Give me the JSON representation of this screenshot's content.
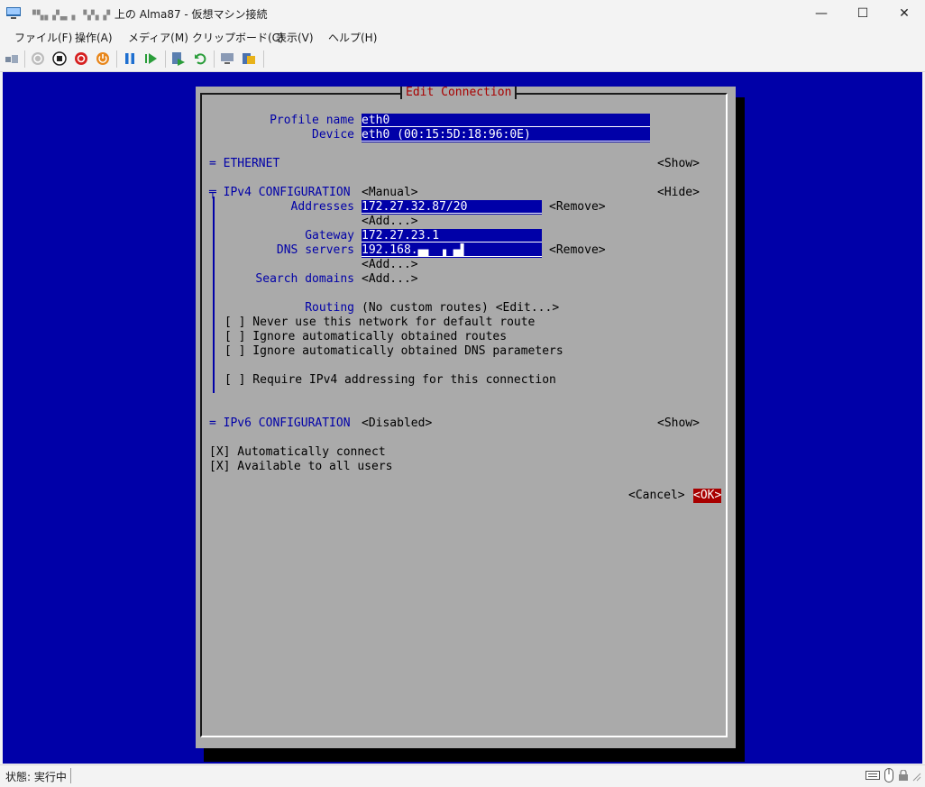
{
  "window": {
    "title_blurred": "▝▚▖▞▃▗ ▝▞▖▞",
    "title": "上の Alma87 - 仮想マシン接続",
    "minimize": "—",
    "maximize": "☐",
    "close": "✕"
  },
  "menu": [
    {
      "label": "ファイル(F)"
    },
    {
      "label": "操作(A)"
    },
    {
      "label": "メディア(M)"
    },
    {
      "label": "クリップボード(C)"
    },
    {
      "label": "表示(V)"
    },
    {
      "label": "ヘルプ(H)"
    }
  ],
  "toolbar_icons": [
    "ctrl-alt-del-icon",
    "start-icon",
    "turn-off-icon",
    "shutdown-icon",
    "power-icon",
    "pause-icon",
    "resume-icon",
    "checkpoint-icon",
    "revert-icon",
    "enhanced-session-icon",
    "share-icon"
  ],
  "dialog": {
    "title": "Edit Connection",
    "profile_name_label": "Profile name",
    "profile_name_value": "eth0",
    "device_label": "Device",
    "device_value": "eth0 (00:15:5D:18:96:0E)",
    "ethernet": {
      "marker": "=",
      "label": "ETHERNET",
      "toggle": "<Show>"
    },
    "ipv4": {
      "marker": "╤",
      "label": "IPv4 CONFIGURATION",
      "mode": "<Manual>",
      "toggle": "<Hide>",
      "addresses_label": "Addresses",
      "address_value": "172.27.32.87/20",
      "remove_label": "<Remove>",
      "add_label": "<Add...>",
      "gateway_label": "Gateway",
      "gateway_value": "172.27.23.1",
      "dns_label": "DNS servers",
      "dns_value": "192.168.▄▖ ▗ ▄▌",
      "dns_remove": "<Remove>",
      "dns_add": "<Add...>",
      "search_label": "Search domains",
      "search_add": "<Add...>",
      "routing_label": "Routing",
      "routing_value": "(No custom routes) <Edit...>",
      "never_default": "[ ] Never use this network for default route",
      "ignore_routes": "[ ] Ignore automatically obtained routes",
      "ignore_dns": "[ ] Ignore automatically obtained DNS parameters",
      "require_ipv4": "[ ] Require IPv4 addressing for this connection"
    },
    "ipv6": {
      "marker": "=",
      "label": "IPv6 CONFIGURATION",
      "mode": "<Disabled>",
      "toggle": "<Show>"
    },
    "auto_connect": "[X] Automatically connect",
    "all_users": "[X] Available to all users",
    "cancel": "<Cancel>",
    "ok": "<OK>"
  },
  "status": {
    "text": "状態: 実行中"
  },
  "colors": {
    "console_bg": "#0000a8",
    "dialog_bg": "#aaaaaa",
    "accent_red": "#a80000"
  }
}
